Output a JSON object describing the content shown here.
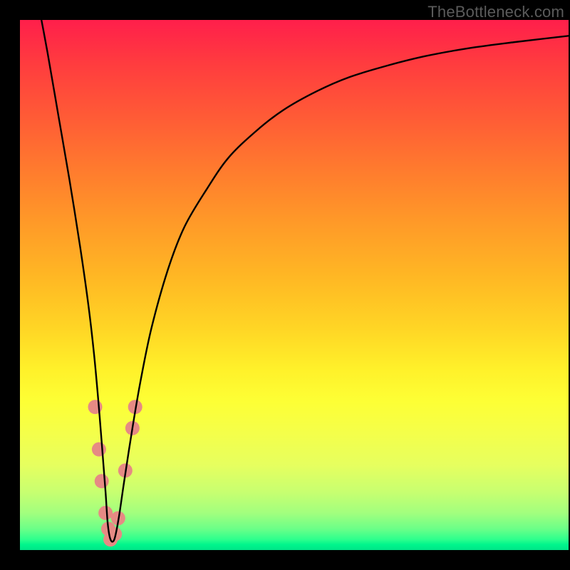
{
  "watermark": "TheBottleneck.com",
  "chart_data": {
    "type": "line",
    "title": "",
    "xlabel": "",
    "ylabel": "",
    "xlim": [
      0,
      100
    ],
    "ylim": [
      0,
      100
    ],
    "grid": false,
    "legend": false,
    "series": [
      {
        "name": "bottleneck-curve",
        "x": [
          3,
          5,
          7,
          9,
          11,
          12.5,
          13.5,
          14.3,
          15,
          15.6,
          16,
          16.5,
          17.2,
          18,
          19,
          20.5,
          22,
          24,
          27,
          30,
          34,
          38,
          43,
          48,
          54,
          60,
          67,
          74,
          82,
          90,
          100
        ],
        "values": [
          105,
          94,
          82,
          70,
          57,
          46,
          37,
          28,
          19,
          11,
          5,
          2,
          2,
          6,
          13,
          23,
          32,
          42,
          53,
          61,
          68,
          74,
          79,
          83,
          86.5,
          89.2,
          91.4,
          93.2,
          94.7,
          95.8,
          97
        ]
      }
    ],
    "markers": [
      {
        "x": 13.7,
        "y": 27,
        "color": "#e68a84",
        "r": 10
      },
      {
        "x": 14.4,
        "y": 19,
        "color": "#e68a84",
        "r": 10
      },
      {
        "x": 14.9,
        "y": 13,
        "color": "#e68a84",
        "r": 10
      },
      {
        "x": 15.6,
        "y": 7,
        "color": "#e68a84",
        "r": 10
      },
      {
        "x": 16.1,
        "y": 4,
        "color": "#e68a84",
        "r": 10
      },
      {
        "x": 16.5,
        "y": 2,
        "color": "#e68a84",
        "r": 10
      },
      {
        "x": 17.3,
        "y": 3,
        "color": "#e68a84",
        "r": 10
      },
      {
        "x": 17.9,
        "y": 6,
        "color": "#e68a84",
        "r": 10
      },
      {
        "x": 19.2,
        "y": 15,
        "color": "#e68a84",
        "r": 10
      },
      {
        "x": 20.5,
        "y": 23,
        "color": "#e68a84",
        "r": 10
      },
      {
        "x": 21.0,
        "y": 27,
        "color": "#e68a84",
        "r": 10
      }
    ],
    "gradient_stops": [
      {
        "pct": 0,
        "color": "#ff1f4b"
      },
      {
        "pct": 8,
        "color": "#ff3b3f"
      },
      {
        "pct": 18,
        "color": "#ff5a36"
      },
      {
        "pct": 28,
        "color": "#ff7a2e"
      },
      {
        "pct": 38,
        "color": "#ff9928"
      },
      {
        "pct": 48,
        "color": "#ffb624"
      },
      {
        "pct": 58,
        "color": "#ffd525"
      },
      {
        "pct": 66,
        "color": "#fff12a"
      },
      {
        "pct": 72,
        "color": "#fdff35"
      },
      {
        "pct": 78,
        "color": "#f4ff4a"
      },
      {
        "pct": 84,
        "color": "#e6ff5f"
      },
      {
        "pct": 89,
        "color": "#c8ff70"
      },
      {
        "pct": 93,
        "color": "#a2ff7e"
      },
      {
        "pct": 96,
        "color": "#6bff88"
      },
      {
        "pct": 98,
        "color": "#2dff8d"
      },
      {
        "pct": 99,
        "color": "#00f58c"
      },
      {
        "pct": 100,
        "color": "#00e588"
      }
    ]
  }
}
